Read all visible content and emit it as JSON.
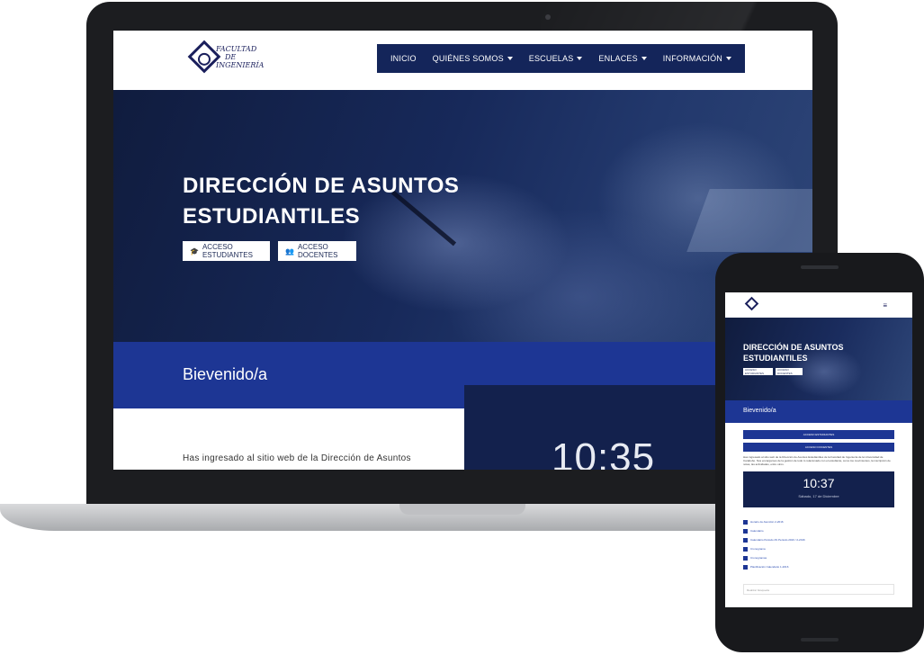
{
  "laptop": {
    "nav": {
      "items": [
        {
          "label": "INICIO",
          "has_caret": false
        },
        {
          "label": "QUIÉNES SOMOS",
          "has_caret": true
        },
        {
          "label": "ESCUELAS",
          "has_caret": true
        },
        {
          "label": "ENLACES",
          "has_caret": true
        },
        {
          "label": "INFORMACIÓN",
          "has_caret": true
        }
      ]
    },
    "logo_text": [
      "FACULTAD",
      "DE",
      "INGENIERÍA"
    ],
    "hero": {
      "title": "DIRECCIÓN DE ASUNTOS ESTUDIANTILES",
      "btn_students": "ACCESO ESTUDIANTES",
      "btn_teachers": "ACCESO DOCENTES"
    },
    "welcome": "Bievenido/a",
    "intro": "Has ingresado al sitio web de la Dirección de Asuntos",
    "clock": "10:35"
  },
  "phone": {
    "hero_title": "DIRECCIÓN DE ASUNTOS ESTUDIANTILES",
    "btn_students": "ACCESO ESTUDIANTES",
    "btn_teachers": "ACCESO DOCENTES",
    "welcome": "Bievenido/a",
    "btn_students_full": "ACCESO ESTUDIANTES",
    "btn_teachers_full": "ACCESO DOCENTES",
    "intro": "Has ingresado al sitio web de la Dirección de Asuntos Estudiantiles de la Facultad de Ingeniería de la Universidad de Carabobo. Nos encargamos de la gestión de todo lo relacionado con el estudiante, como los movimientos, la inscripción de notas, las actividades, entre otros.",
    "clock_time": "10:37",
    "clock_date": "Sábado, 17 de Diciembre",
    "links": [
      "Horario de Atención 2-2016",
      "Calendario",
      "Calendario Periodo 2S Periodo 2016 / 2-2016",
      "Cronograma",
      "Cronogramas",
      "Planificación Calendario 1-2016"
    ],
    "search_placeholder": "Realizar búsqueda"
  },
  "colors": {
    "navy": "#14255a",
    "band_blue": "#1d3694",
    "clock_bg": "#13214d"
  }
}
